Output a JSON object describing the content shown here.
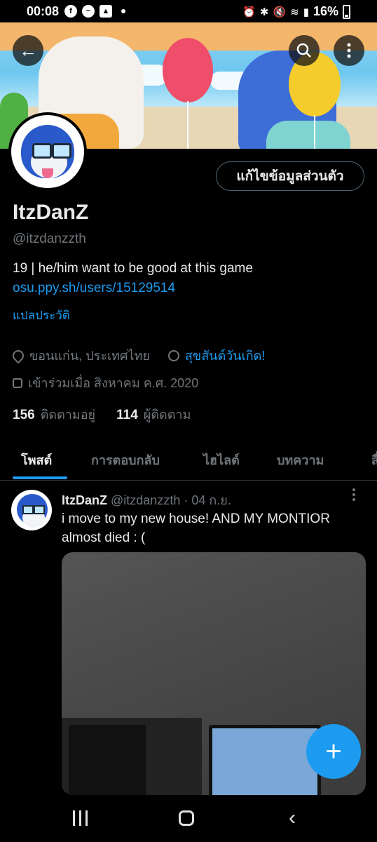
{
  "status_bar": {
    "time": "00:08",
    "battery": "16%",
    "left_icons": [
      "facebook-icon",
      "messenger-icon",
      "gallery-icon"
    ],
    "right_icons": [
      "alarm-icon",
      "bluetooth-icon",
      "mute-icon",
      "wifi-icon",
      "signal-icon"
    ]
  },
  "profile": {
    "edit_button": "แก้ไขข้อมูลส่วนตัว",
    "name": "ItzDanZ",
    "handle": "@itzdanzzth",
    "bio": "19 | he/him  want to be good at this game",
    "link": "osu.ppy.sh/users/15129514",
    "translate": "แปลประวัติ",
    "location": "ขอนแก่น, ประเทศไทย",
    "birthday": "สุขสันต์วันเกิด!",
    "joined": "เข้าร่วมเมื่อ สิงหาคม ค.ศ. 2020",
    "following_count": "156",
    "following_label": "ติดตามอยู่",
    "followers_count": "114",
    "followers_label": "ผู้ติดตาม"
  },
  "tabs": [
    "โพสต์",
    "การตอบกลับ",
    "ไฮไลต์",
    "บทความ",
    "สื่อ"
  ],
  "post": {
    "name": "ItzDanZ",
    "handle": "@itzdanzzth",
    "date": "· 04 ก.ย.",
    "text": "i move to my new house! AND MY MONTIOR almost died : ("
  },
  "colors": {
    "accent": "#1d9bf0",
    "background": "#000000",
    "muted": "#71767b"
  }
}
